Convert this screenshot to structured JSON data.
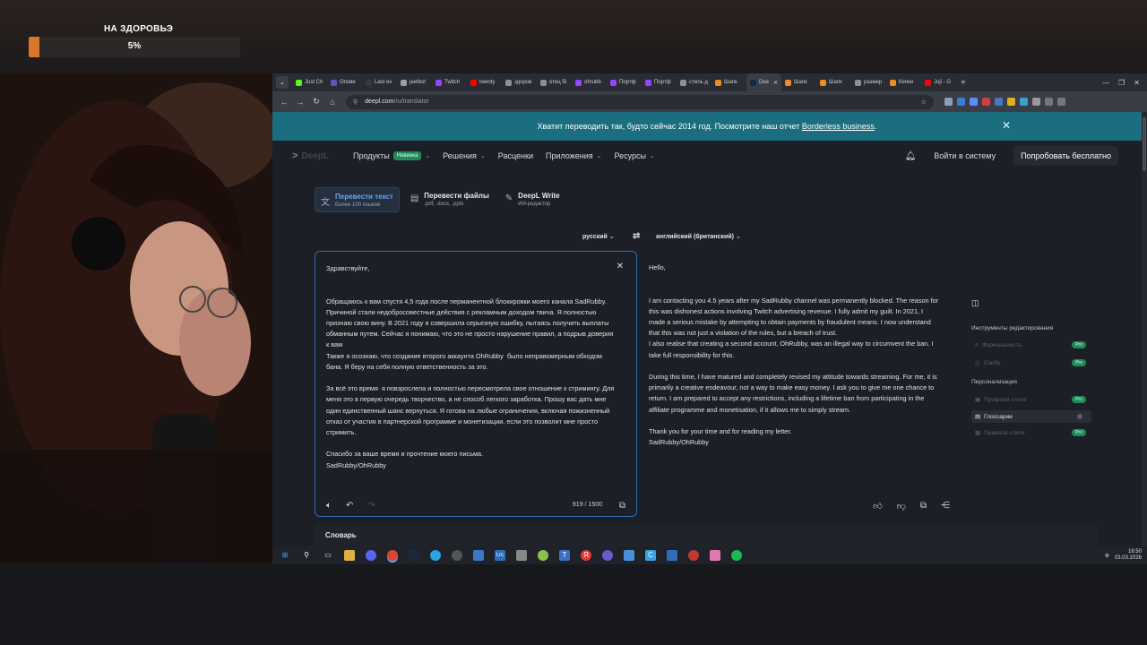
{
  "overlay": {
    "goal_title": "НА ЗДОРОВЬЭ",
    "goal_percent_text": "5%",
    "goal_progress": 0.05
  },
  "tabs": [
    {
      "label": "Just Ch",
      "color": "#53fc18"
    },
    {
      "label": "Опове",
      "color": "#6b4fbb"
    },
    {
      "label": "Last ev",
      "color": "#333a46"
    },
    {
      "label": "jeetbot",
      "color": "#9aa0aa"
    },
    {
      "label": "Twitch",
      "color": "#9146ff"
    },
    {
      "label": "twenty",
      "color": "#ff0000"
    },
    {
      "label": "здоров",
      "color": "#8a8f99"
    },
    {
      "label": "отец бі",
      "color": "#8a8f99"
    },
    {
      "label": "ohrubb",
      "color": "#9146ff"
    },
    {
      "label": "Портф",
      "color": "#9146ff"
    },
    {
      "label": "Портф",
      "color": "#9146ff"
    },
    {
      "label": "стиль д",
      "color": "#8a8f99"
    },
    {
      "label": "Шапк",
      "color": "#f28c1e"
    },
    {
      "label": "Dee",
      "color": "#0f2b46",
      "active": true
    },
    {
      "label": "Шапк",
      "color": "#f28c1e"
    },
    {
      "label": "Шапк",
      "color": "#f28c1e"
    },
    {
      "label": "размер",
      "color": "#8a8f99"
    },
    {
      "label": "Кепки",
      "color": "#f28c1e"
    },
    {
      "label": "Joji - G",
      "color": "#ff0000"
    }
  ],
  "address": {
    "domain": "deepl.com",
    "path": "/ru/translator"
  },
  "banner": {
    "text": "Хватит переводить так, будто сейчас 2014 год. Посмотрите наш отчет ",
    "link": "Borderless business",
    "suffix": "."
  },
  "site_nav": {
    "logo": "DeepL",
    "products": "Продукты",
    "new_badge": "Новинка",
    "solutions": "Решения",
    "pricing": "Расценки",
    "apps": "Приложения",
    "resources": "Ресурсы",
    "login": "Войти в систему",
    "try_free": "Попробовать бесплатно"
  },
  "modes": [
    {
      "title": "Перевести текст",
      "subtitle": "Более 100 языков",
      "icon": "translate-icon"
    },
    {
      "title": "Перевести файлы",
      "subtitle": ".pdf, .docx, .pptx",
      "icon": "file-icon"
    },
    {
      "title": "DeepL Write",
      "subtitle": "ИИ-редактор",
      "icon": "write-icon"
    }
  ],
  "languages": {
    "source": "русский",
    "target": "английский (британский)"
  },
  "source_text": "Здравствуйте,\n\n\nОбращаюсь к вам спустя 4,5 года после перманентной блокировки моего канала SadRubby. Причиной стали недобросовестные действия с рекламным доходом твича. Я полностью признаю свою вину. В 2021 году я совершила серьезную ошибку, пытаясь получить выплаты обманным путем. Сейчас я понимаю, что это не просто нарушение правил, а подрыв доверия к вам\nТакже я осознаю, что создание второго аккаунта OhRubby  было неправомерным обходом бана. Я беру на себя полную ответственность за это.\n\nЗа всё это время  я повзрослела и полностью пересмотрела свое отношение к стримингу. Для меня это в первую очередь творчество, а не способ легкого заработка. Прошу вас дать мне один единственный шанс вернуться. Я готова на любые ограничения, включая пожизненный отказ от участия в партнерской программе и монетизации, если это позволит мне просто стримить.\n\nСпасибо за ваше время и прочтение моего письма.\nSadRubby/OhRubby",
  "target_text": "Hello,\n\n\nI am contacting you 4.5 years after my SadRubby channel was permanently blocked. The reason for this was dishonest actions involving Twitch advertising revenue. I fully admit my guilt. In 2021, I made a serious mistake by attempting to obtain payments by fraudulent means. I now understand that this was not just a violation of the rules, but a breach of trust.\nI also realise that creating a second account, OhRubby, was an illegal way to circumvent the ban. I take full responsibility for this.\n\nDuring this time, I have matured and completely revised my attitude towards streaming. For me, it is primarily a creative endeavour, not a way to make easy money. I ask you to give me one chance to return. I am prepared to accept any restrictions, including a lifetime ban from participating in the affiliate programme and monetisation, if it allows me to simply stream.\n\nThank you for your time and for reading my letter.\nSadRubby/OhRubby",
  "char_counter": "919 / 1500",
  "dictionary_label": "Словарь",
  "sidebar": {
    "editing_tools": "Инструменты редактирования",
    "formality": "Формальность",
    "clarify": "Clarify",
    "personalization": "Персонализация",
    "style_profiles": "Профили стиля",
    "glossaries": "Глоссарии",
    "style_rules": "Правила стиля",
    "pro_badge": "Pro"
  },
  "clock": {
    "time": "16:50",
    "date": "03.03.2026"
  }
}
